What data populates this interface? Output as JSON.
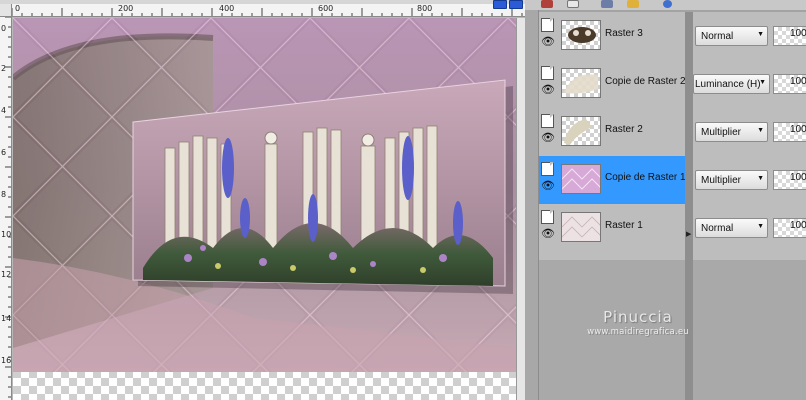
{
  "canvas": {
    "h_ruler_labels": [
      "0",
      "200",
      "400",
      "600",
      "800"
    ],
    "v_ruler_labels": [
      "0",
      "2",
      "4",
      "6",
      "8",
      "10",
      "12",
      "14",
      "16"
    ]
  },
  "panel": {
    "layers": [
      {
        "name": "Raster 3",
        "blend": "Normal",
        "opacity": "100",
        "selected": false
      },
      {
        "name": "Copie de Raster 2",
        "blend": "Luminance (H)",
        "opacity": "100",
        "selected": false
      },
      {
        "name": "Raster 2",
        "blend": "Multiplier",
        "opacity": "100",
        "selected": false
      },
      {
        "name": "Copie de Raster 1",
        "blend": "Multiplier",
        "opacity": "100",
        "selected": true
      },
      {
        "name": "Raster 1",
        "blend": "Normal",
        "opacity": "100",
        "selected": false
      }
    ]
  },
  "watermark": {
    "name": "Pinuccia",
    "url": "www.maidiregrafica.eu"
  },
  "icons": [
    "visibility-eye-icon",
    "layer-doc-icon",
    "dropdown-arrow-icon",
    "link-icon",
    "lock-icon",
    "globe-icon"
  ],
  "colors": {
    "selection": "#3399ff",
    "panel_bg": "#bdbdbd",
    "canvas_mauve": "#a6849f"
  }
}
